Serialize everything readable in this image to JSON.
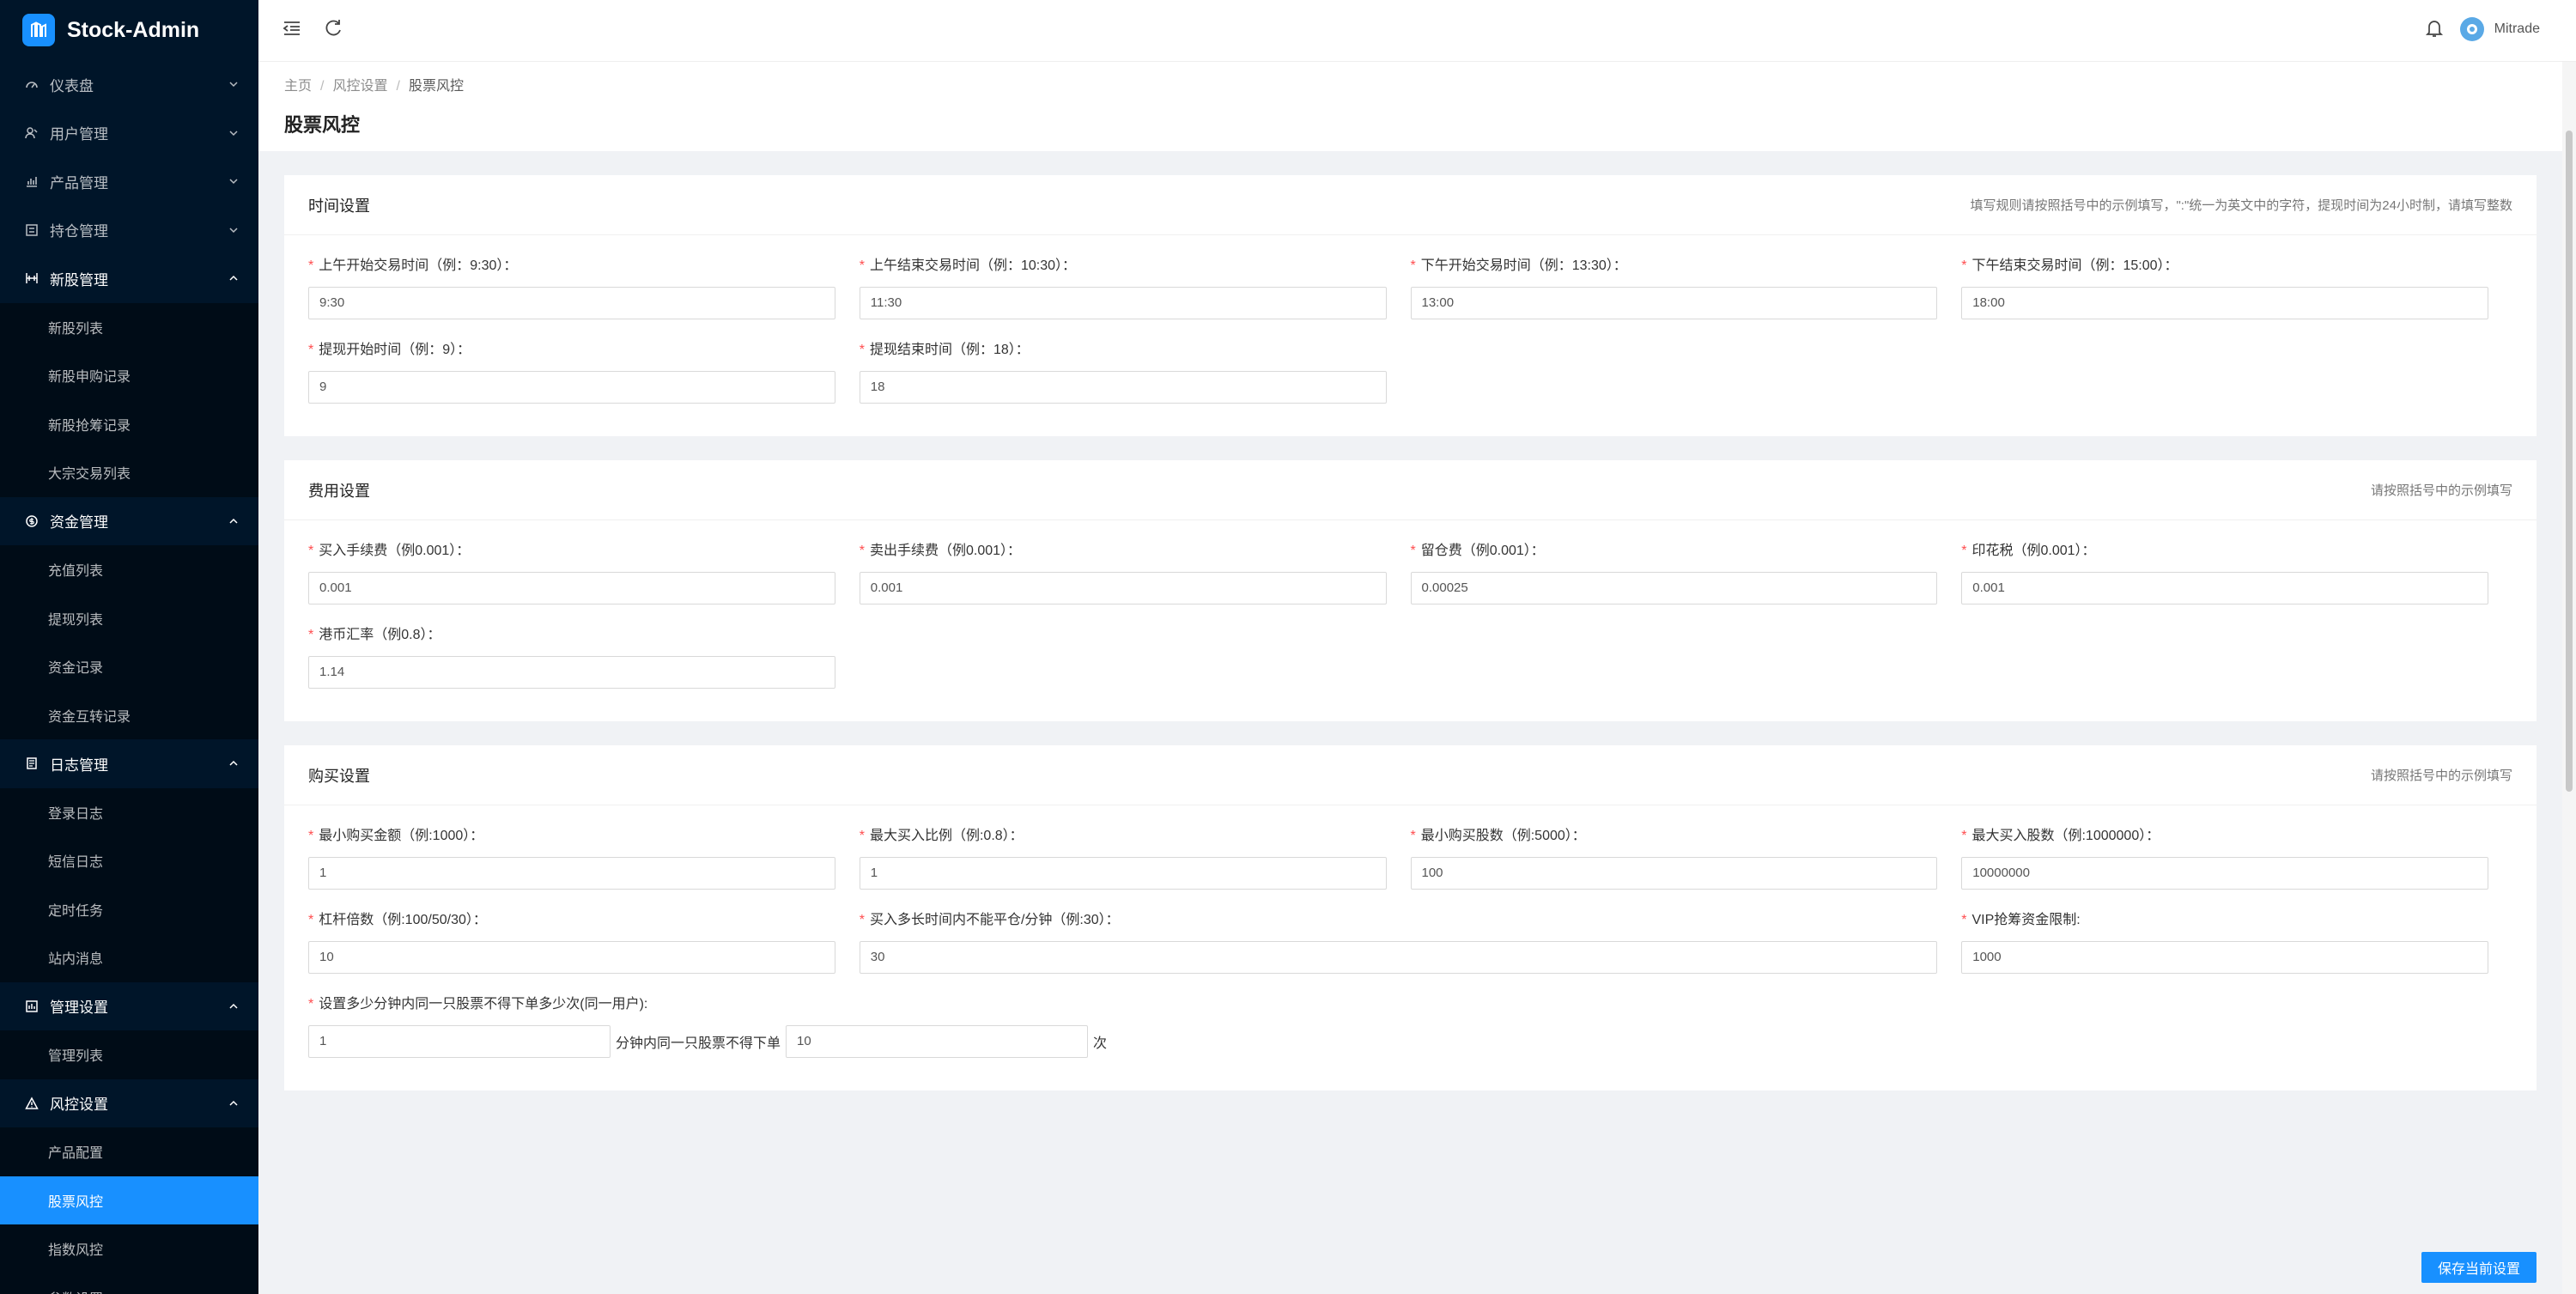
{
  "app": {
    "name": "Stock-Admin"
  },
  "sidebar": {
    "groups": [
      {
        "label": "仪表盘",
        "icon": "dashboard-icon",
        "open": false,
        "items": []
      },
      {
        "label": "用户管理",
        "icon": "users-icon",
        "open": false,
        "items": []
      },
      {
        "label": "产品管理",
        "icon": "chart-icon",
        "open": false,
        "items": []
      },
      {
        "label": "持仓管理",
        "icon": "position-icon",
        "open": false,
        "items": []
      },
      {
        "label": "新股管理",
        "icon": "ipo-icon",
        "open": true,
        "items": [
          "新股列表",
          "新股申购记录",
          "新股抢筹记录",
          "大宗交易列表"
        ]
      },
      {
        "label": "资金管理",
        "icon": "money-icon",
        "open": true,
        "items": [
          "充值列表",
          "提现列表",
          "资金记录",
          "资金互转记录"
        ]
      },
      {
        "label": "日志管理",
        "icon": "log-icon",
        "open": true,
        "items": [
          "登录日志",
          "短信日志",
          "定时任务",
          "站内消息"
        ]
      },
      {
        "label": "管理设置",
        "icon": "admin-icon",
        "open": true,
        "items": [
          "管理列表"
        ]
      },
      {
        "label": "风控设置",
        "icon": "warning-icon",
        "open": true,
        "items": [
          "产品配置",
          "股票风控",
          "指数风控",
          "参数设置"
        ]
      }
    ],
    "active_item": "股票风控"
  },
  "header": {
    "user_name": "Mitrade"
  },
  "breadcrumb": {
    "items": [
      "主页",
      "风控设置",
      "股票风控"
    ]
  },
  "page_title": "股票风控",
  "sections": {
    "time": {
      "title": "时间设置",
      "tip": "填写规则请按照括号中的示例填写，\":\"统一为英文中的字符，提现时间为24小时制，请填写整数",
      "fields": [
        {
          "label": "上午开始交易时间（例：9:30）：",
          "value": "9:30"
        },
        {
          "label": "上午结束交易时间（例：10:30）：",
          "value": "11:30"
        },
        {
          "label": "下午开始交易时间（例：13:30）：",
          "value": "13:00"
        },
        {
          "label": "下午结束交易时间（例：15:00）：",
          "value": "18:00"
        },
        {
          "label": "提现开始时间（例：9）：",
          "value": "9"
        },
        {
          "label": "提现结束时间（例：18）：",
          "value": "18"
        }
      ]
    },
    "fee": {
      "title": "费用设置",
      "tip": "请按照括号中的示例填写",
      "fields": [
        {
          "label": "买入手续费（例0.001）：",
          "value": "0.001"
        },
        {
          "label": "卖出手续费（例0.001）：",
          "value": "0.001"
        },
        {
          "label": "留仓费（例0.001）：",
          "value": "0.00025"
        },
        {
          "label": "印花税（例0.001）：",
          "value": "0.001"
        },
        {
          "label": "港币汇率（例0.8）：",
          "value": "1.14"
        }
      ]
    },
    "buy": {
      "title": "购买设置",
      "tip": "请按照括号中的示例填写",
      "fields": [
        {
          "label": "最小购买金额（例:1000）：",
          "value": "1"
        },
        {
          "label": "最大买入比例（例:0.8）：",
          "value": "1"
        },
        {
          "label": "最小购买股数（例:5000）：",
          "value": "100"
        },
        {
          "label": "最大买入股数（例:1000000）：",
          "value": "10000000"
        },
        {
          "label": "杠杆倍数（例:100/50/30）：",
          "value": "10"
        },
        {
          "label": "买入多长时间内不能平仓/分钟（例:30）：",
          "value": "30"
        },
        {
          "label": "VIP抢筹资金限制:",
          "value": "1000"
        }
      ],
      "limit_row": {
        "label": "设置多少分钟内同一只股票不得下单多少次(同一用户):",
        "minutes": "1",
        "middle_text": "分钟内同一只股票不得下单",
        "times": "10",
        "suffix": "次"
      }
    }
  },
  "save_button": "保存当前设置",
  "colors": {
    "sidebar": "#001529",
    "submenu": "#000c17",
    "accent": "#1890ff",
    "required": "#ff4d4f"
  }
}
